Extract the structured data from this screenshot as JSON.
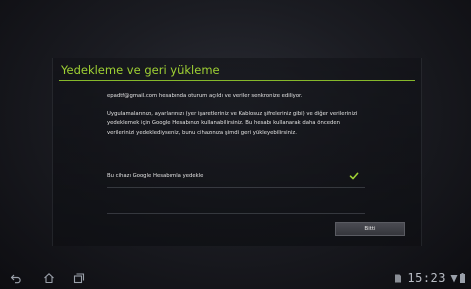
{
  "setup": {
    "title": "Yedekleme ve geri yükleme",
    "account_message": "epadtf@gmail.com hesabında oturum açıldı ve veriler senkronize ediliyor.",
    "description": "Uygulamalarınızı, ayarlarınızı (yer işaretleriniz ve Kablosuz şifreleriniz gibi) ve diğer verilerinizi yedeklemek için Google Hesabınızı kullanabilirsiniz. Bu hesabı kullanarak daha önceden verilerinizi yedeklediyseniz, bunu cihazınıza şimdi geri yükleyebilirsiniz.",
    "backup_option": {
      "label": "Bu cihazı Google Hesabımla yedekle",
      "checked": true
    },
    "next_button": "Bitti"
  },
  "colors": {
    "accent": "#9fd134",
    "text": "#e4e4e4"
  },
  "navbar": {
    "buttons": [
      "back-icon",
      "home-icon",
      "recent-apps-icon"
    ]
  },
  "statusbar": {
    "time": "15:23",
    "icons": [
      "sd-card-icon",
      "wifi-icon",
      "battery-icon"
    ]
  }
}
